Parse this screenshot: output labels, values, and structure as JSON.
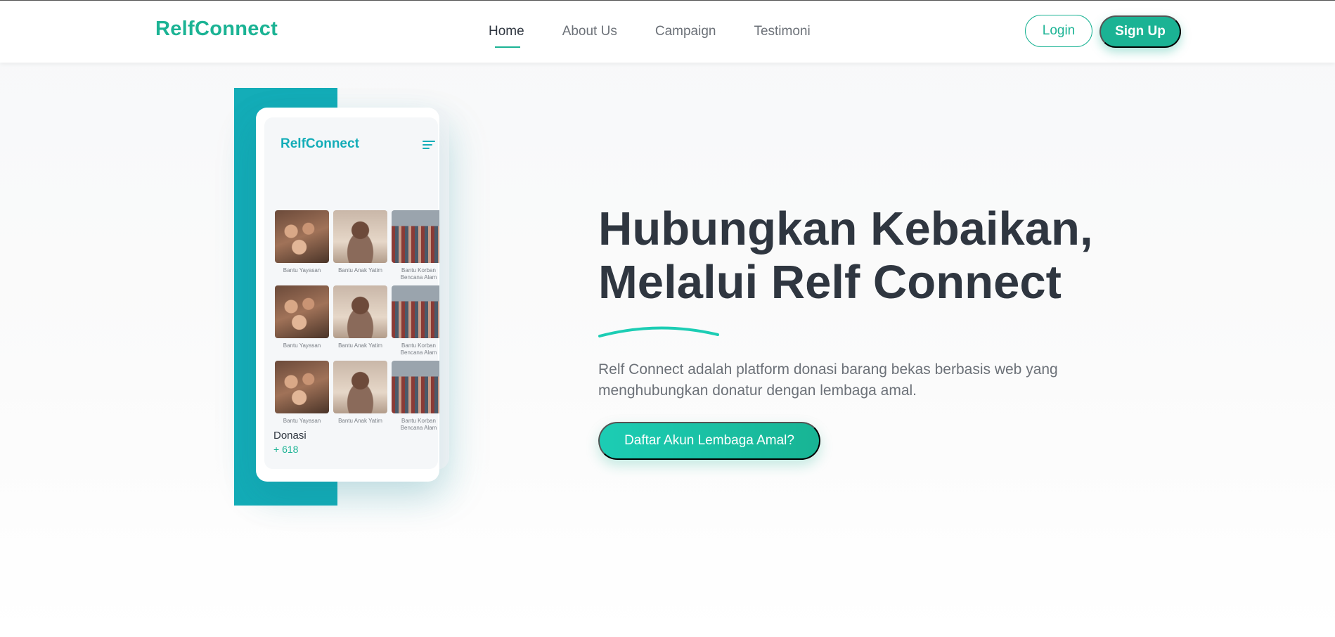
{
  "header": {
    "logo": "RelfConnect",
    "nav": [
      {
        "label": "Home",
        "active": true
      },
      {
        "label": "About Us",
        "active": false
      },
      {
        "label": "Campaign",
        "active": false
      },
      {
        "label": "Testimoni",
        "active": false
      }
    ],
    "login_label": "Login",
    "signup_label": "Sign Up"
  },
  "phone": {
    "logo": "RelfConnect",
    "menu_icon": "menu-icon",
    "grid": [
      {
        "caption": "Bantu Yayasan",
        "image": "children-photo"
      },
      {
        "caption": "Bantu Anak Yatim",
        "image": "boy-photo"
      },
      {
        "caption": "Bantu Korban Bencana Alam",
        "image": "crowd-photo"
      },
      {
        "caption": "Bantu Yayasan",
        "image": "children-photo"
      },
      {
        "caption": "Bantu Anak Yatim",
        "image": "boy-photo"
      },
      {
        "caption": "Bantu Korban Bencana Alam",
        "image": "crowd-photo"
      },
      {
        "caption": "Bantu Yayasan",
        "image": "children-photo"
      },
      {
        "caption": "Bantu Anak Yatim",
        "image": "boy-photo"
      },
      {
        "caption": "Bantu Korban Bencana Alam",
        "image": "crowd-photo"
      }
    ],
    "donasi_label": "Donasi",
    "donasi_count": "+ 618"
  },
  "hero": {
    "title_line1": "Hubungkan Kebaikan,",
    "title_line2": "Melalui Relf Connect",
    "description": "Relf Connect adalah platform donasi barang bekas berbasis web yang menghubungkan donatur dengan lembaga amal.",
    "cta_label": "Daftar Akun Lembaga Amal?"
  },
  "colors": {
    "brand": "#1bb394",
    "accent_teal": "#14adb8",
    "text_dark": "#2f3640",
    "text_muted": "#6c7178"
  }
}
